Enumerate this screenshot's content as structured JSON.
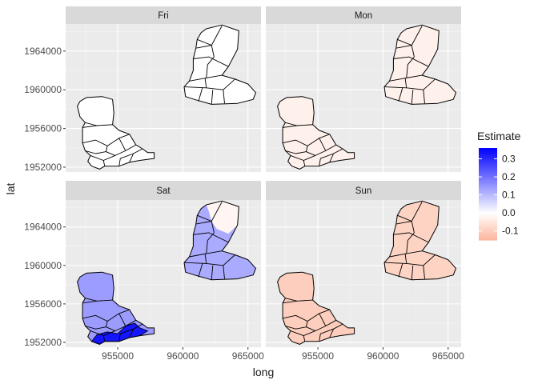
{
  "chart_data": {
    "type": "choropleth-facets",
    "xlabel": "long",
    "ylabel": "lat",
    "xlim": [
      951000,
      966000
    ],
    "ylim": [
      1951500,
      1966800
    ],
    "x_ticks": [
      {
        "value": 955000,
        "label": "955000"
      },
      {
        "value": 960000,
        "label": "960000"
      },
      {
        "value": 965000,
        "label": "965000"
      }
    ],
    "y_ticks": [
      {
        "value": 1952000,
        "label": "1952000"
      },
      {
        "value": 1956000,
        "label": "1956000"
      },
      {
        "value": 1960000,
        "label": "1960000"
      },
      {
        "value": 1964000,
        "label": "1964000"
      }
    ],
    "legend": {
      "title": "Estimate",
      "placement": "right",
      "range": [
        -0.15,
        0.36
      ],
      "labels": [
        {
          "value": 0.3,
          "label": "0.3"
        },
        {
          "value": 0.2,
          "label": "0.2"
        },
        {
          "value": 0.1,
          "label": "0.1"
        },
        {
          "value": 0.0,
          "label": "0.0"
        },
        {
          "value": -0.1,
          "label": "-0.1"
        }
      ],
      "colors": {
        "low": "#fcb59c",
        "mid": "#ffffff",
        "high": "#0000ff"
      }
    },
    "facets": [
      {
        "name": "Fri",
        "estimate_north": 0.0,
        "estimate_south": 0.0
      },
      {
        "name": "Mon",
        "estimate_north": -0.03,
        "estimate_south": -0.03
      },
      {
        "name": "Sat",
        "estimate_north": 0.12,
        "estimate_south": 0.14
      },
      {
        "name": "Sun",
        "estimate_north": -0.09,
        "estimate_south": -0.1
      }
    ]
  }
}
